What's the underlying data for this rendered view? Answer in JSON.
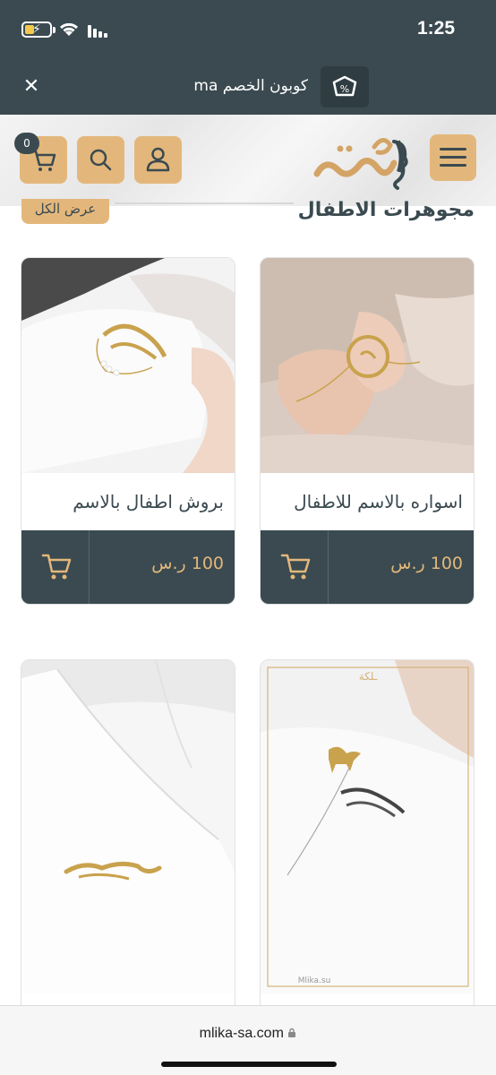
{
  "status_bar": {
    "time": "1:25"
  },
  "coupon": {
    "text": "كوبون الخصم ma"
  },
  "header": {
    "cart_count": "0"
  },
  "section": {
    "title": "مجوهرات الاطفال",
    "view_all": "عرض الكل"
  },
  "products": [
    {
      "name": "اسواره بالاسم للاطفال",
      "price": "100 ر.س"
    },
    {
      "name": "بروش اطفال بالاسم",
      "price": "100 ر.س"
    },
    {
      "name": "",
      "price": ""
    },
    {
      "name": "",
      "price": ""
    }
  ],
  "browser": {
    "url": "mlika-sa.com"
  },
  "colors": {
    "dark": "#3a4a50",
    "gold": "#e3b77b"
  }
}
